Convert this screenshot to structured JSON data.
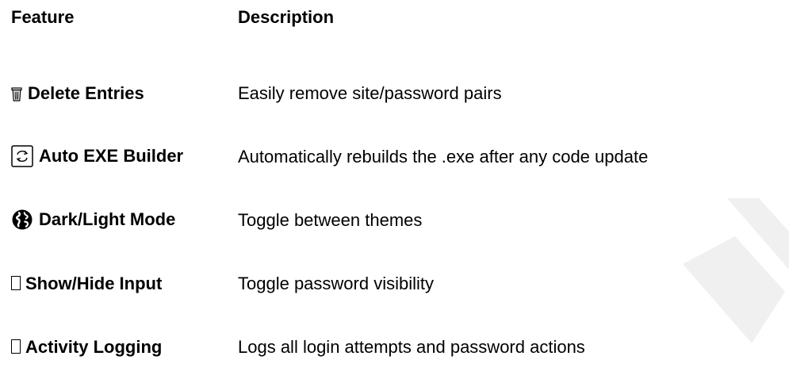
{
  "table": {
    "headers": {
      "feature": "Feature",
      "description": "Description"
    },
    "rows": [
      {
        "icon": "trash-icon",
        "feature": "Delete Entries",
        "description": "Easily remove site/password pairs"
      },
      {
        "icon": "cycle-arrows-icon",
        "feature": "Auto EXE Builder",
        "description": "Automatically rebuilds the .exe after any code update"
      },
      {
        "icon": "globe-icon",
        "feature": "Dark/Light Mode",
        "description": "Toggle between themes"
      },
      {
        "icon": "missing-glyph-icon",
        "feature": "Show/Hide Input",
        "description": "Toggle password visibility"
      },
      {
        "icon": "missing-glyph-icon",
        "feature": "Activity Logging",
        "description": "Logs all login attempts and password actions"
      }
    ]
  },
  "colors": {
    "text": "#000000",
    "background": "#ffffff",
    "watermark": "#f0f0f0"
  }
}
